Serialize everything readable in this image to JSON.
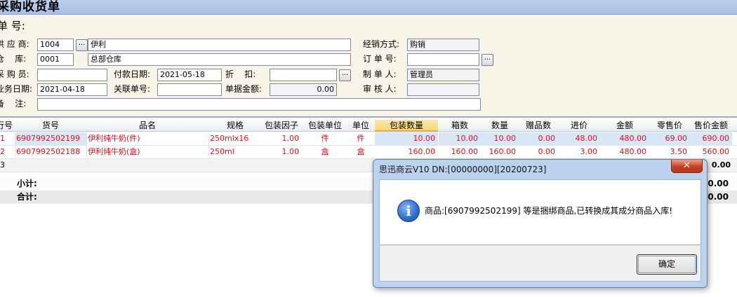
{
  "window": {
    "title": "采购收货单"
  },
  "form": {
    "bill_no_label": "单 号:",
    "supplier_label": "供 应 商:",
    "supplier_code": "1004",
    "supplier_name": "伊利",
    "warehouse_label": "仓    库:",
    "warehouse_code": "0001",
    "warehouse_name": "总部仓库",
    "buyer_label": "采 购 员:",
    "buyer": "",
    "pay_date_label": "付款日期:",
    "pay_date": "2021-05-18",
    "discount_label": "折    扣:",
    "discount": "",
    "biz_date_label": "业务日期:",
    "biz_date": "2021-04-18",
    "related_no_label": "关联单号:",
    "related_no": "",
    "bill_amount_label": "单据金额:",
    "bill_amount": "0.00",
    "remark_label": "备    注:",
    "remark": "",
    "sales_mode_label": "经销方式:",
    "sales_mode": "购销",
    "order_no_label": "订 单 号:",
    "order_no": "",
    "maker_label": "制 单 人:",
    "maker": "管理员",
    "auditor_label": "审 核 人:",
    "auditor": "",
    "lookup_button": "..."
  },
  "table": {
    "headers": [
      "行号",
      "货号",
      "品名",
      "规格",
      "包装因子",
      "包装单位",
      "单位",
      "包装数量",
      "箱数",
      "数量",
      "赠品数",
      "进价",
      "金额",
      "零售价",
      "售价金额"
    ],
    "rows": [
      {
        "no": "1",
        "code": "6907992502199",
        "name": "伊利纯牛奶(件)",
        "spec": "250mlx16",
        "factor": "1.00",
        "pack_unit": "件",
        "unit": "件",
        "pack_qty": "10.00",
        "boxes": "10.00",
        "qty": "10.00",
        "gift": "0.00",
        "cost": "48.00",
        "amount": "480.00",
        "retail": "69.00",
        "retail_amount": "690.00"
      },
      {
        "no": "2",
        "code": "6907992502188",
        "name": "伊利纯牛奶(盒)",
        "spec": "250ml",
        "factor": "1.00",
        "pack_unit": "盒",
        "unit": "盒",
        "pack_qty": "160.00",
        "boxes": "160.00",
        "qty": "160.00",
        "gift": "0.00",
        "cost": "3.00",
        "amount": "480.00",
        "retail": "3.50",
        "retail_amount": "560.00"
      },
      {
        "no": "3"
      }
    ],
    "subtotal_label": "小计:",
    "total_label": "合计:",
    "peek_row3": "0.00",
    "peek_subtotal": "0.00",
    "peek_total": "0.00"
  },
  "dialog": {
    "title": "思迅商云V10 DN:[00000000][20200723]",
    "close_label": "✕",
    "icon": "info-icon",
    "message": "商品:[6907992502199] 等是捆绑商品,已转换成其成分商品入库!",
    "ok_label": "确定"
  },
  "colors": {
    "accent_red": "#d8141c",
    "selected_header": "#f6d77a",
    "titlebar": "#a7bfe3"
  }
}
